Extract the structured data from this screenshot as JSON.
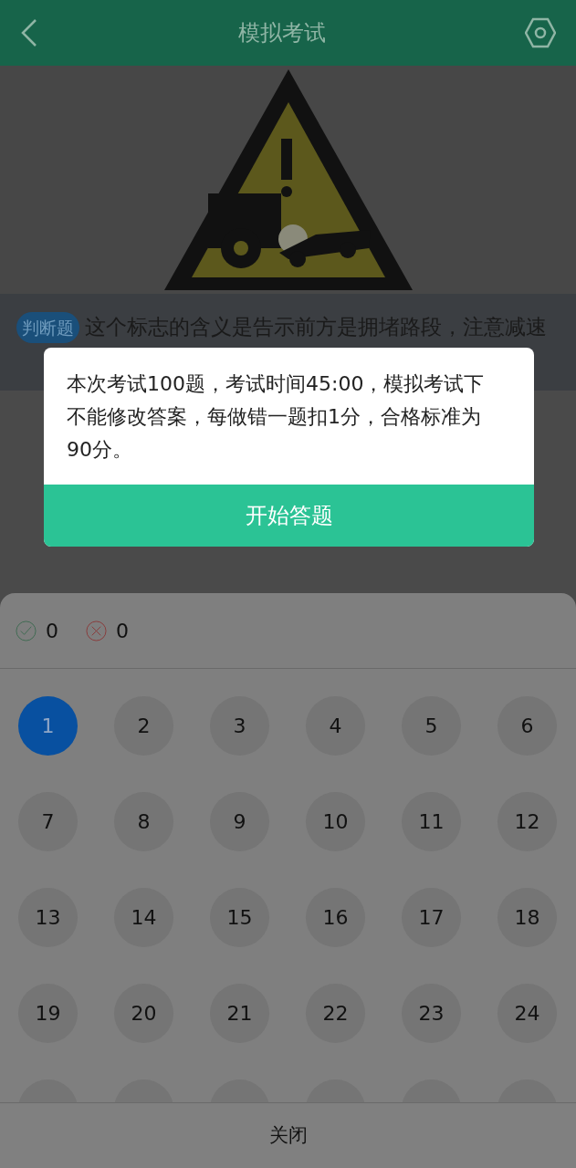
{
  "header": {
    "title": "模拟考试"
  },
  "question": {
    "type_badge": "判断题",
    "text": "这个标志的含义是告示前方是拥堵路段，注意减速"
  },
  "dialog": {
    "message": "本次考试100题，考试时间45:00，模拟考试下不能修改答案，每做错一题扣1分，合格标准为90分。",
    "button": "开始答题"
  },
  "answer_sheet": {
    "correct_count": "0",
    "wrong_count": "0",
    "numbers": [
      {
        "label": "1",
        "selected": true
      },
      {
        "label": "2",
        "selected": false
      },
      {
        "label": "3",
        "selected": false
      },
      {
        "label": "4",
        "selected": false
      },
      {
        "label": "5",
        "selected": false
      },
      {
        "label": "6",
        "selected": false
      },
      {
        "label": "7",
        "selected": false
      },
      {
        "label": "8",
        "selected": false
      },
      {
        "label": "9",
        "selected": false
      },
      {
        "label": "10",
        "selected": false
      },
      {
        "label": "11",
        "selected": false
      },
      {
        "label": "12",
        "selected": false
      },
      {
        "label": "13",
        "selected": false
      },
      {
        "label": "14",
        "selected": false
      },
      {
        "label": "15",
        "selected": false
      },
      {
        "label": "16",
        "selected": false
      },
      {
        "label": "17",
        "selected": false
      },
      {
        "label": "18",
        "selected": false
      },
      {
        "label": "19",
        "selected": false
      },
      {
        "label": "20",
        "selected": false
      },
      {
        "label": "21",
        "selected": false
      },
      {
        "label": "22",
        "selected": false
      },
      {
        "label": "23",
        "selected": false
      },
      {
        "label": "24",
        "selected": false
      }
    ],
    "close_button": "关闭"
  }
}
